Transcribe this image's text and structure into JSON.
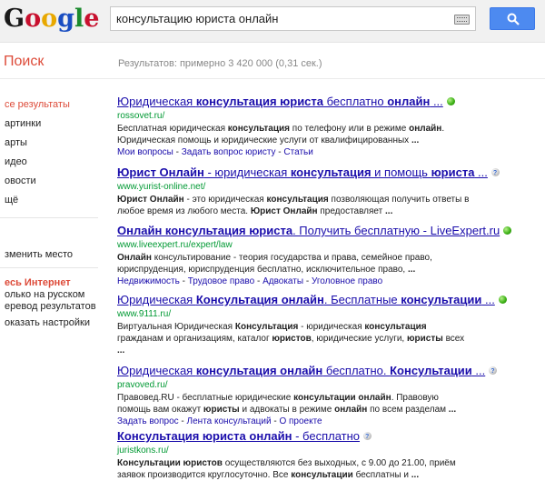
{
  "header": {
    "logo_letters": [
      {
        "ch": "G",
        "color": "#1a1a1a"
      },
      {
        "ch": "o",
        "color": "#c8102e"
      },
      {
        "ch": "o",
        "color": "#e8a800"
      },
      {
        "ch": "g",
        "color": "#1a4ec2"
      },
      {
        "ch": "l",
        "color": "#1b8a2e"
      },
      {
        "ch": "e",
        "color": "#c8102e"
      }
    ],
    "search_query": "консультацию юриста онлайн"
  },
  "section_title": "Поиск",
  "stats": "Результатов: примерно 3 420 000 (0,31 сек.)",
  "sidebar": {
    "nav": [
      {
        "label": "се результаты",
        "active": true
      },
      {
        "label": "артинки",
        "active": false
      },
      {
        "label": "арты",
        "active": false
      },
      {
        "label": "идео",
        "active": false
      },
      {
        "label": "овости",
        "active": false
      },
      {
        "label": "щё",
        "active": false
      }
    ],
    "location": "зменить место",
    "filter_head": "есь Интернет",
    "filters": [
      "олько на русском",
      "еревод результатов"
    ],
    "settings": "оказать настройки"
  },
  "results": [
    {
      "title_parts": [
        {
          "t": "Юридическая ",
          "b": false
        },
        {
          "t": "консультация юриста",
          "b": true
        },
        {
          "t": " бесплатно ",
          "b": false
        },
        {
          "t": "онлайн",
          "b": true
        },
        {
          "t": " ...",
          "b": false
        }
      ],
      "badge": "green",
      "url": "rossovet.ru/",
      "snippet": [
        [
          {
            "t": "Бесплатная юридическая ",
            "b": false
          },
          {
            "t": "консультация",
            "b": true
          },
          {
            "t": " по телефону или в режиме ",
            "b": false
          },
          {
            "t": "онлайн",
            "b": true
          },
          {
            "t": ".",
            "b": false
          }
        ],
        [
          {
            "t": "Юридическая помощь и юридические услуги от квалифицированных ",
            "b": false
          },
          {
            "t": "...",
            "b": true
          }
        ]
      ],
      "sitelinks": [
        "Мои вопросы",
        "Задать вопрос юристу",
        "Статьи"
      ]
    },
    {
      "title_parts": [
        {
          "t": "Юрист Онлайн",
          "b": true
        },
        {
          "t": " - юридическая ",
          "b": false
        },
        {
          "t": "консультация",
          "b": true
        },
        {
          "t": " и помощь ",
          "b": false
        },
        {
          "t": "юриста",
          "b": true
        },
        {
          "t": " ...",
          "b": false
        }
      ],
      "badge": "gray",
      "url": "www.yurist-online.net/",
      "snippet": [
        [
          {
            "t": "Юрист Онлайн",
            "b": true
          },
          {
            "t": " - это юридическая ",
            "b": false
          },
          {
            "t": "консультация",
            "b": true
          },
          {
            "t": " позволяющая получить ответы в",
            "b": false
          }
        ],
        [
          {
            "t": "любое время из любого места. ",
            "b": false
          },
          {
            "t": "Юрист Онлайн",
            "b": true
          },
          {
            "t": " предоставляет ",
            "b": false
          },
          {
            "t": "...",
            "b": true
          }
        ]
      ],
      "sitelinks": []
    },
    {
      "title_parts": [
        {
          "t": "Онлайн консультация юриста",
          "b": true
        },
        {
          "t": ". Получить бесплатную - LiveExpert.ru",
          "b": false
        }
      ],
      "badge": "green",
      "url": "www.liveexpert.ru/expert/law",
      "snippet": [
        [
          {
            "t": "Онлайн",
            "b": true
          },
          {
            "t": " консультирование - теория государства и права, семейное право,",
            "b": false
          }
        ],
        [
          {
            "t": "юриспруденция, юриспруденция бесплатно, исключительное право, ",
            "b": false
          },
          {
            "t": "...",
            "b": true
          }
        ]
      ],
      "sitelinks": [
        "Недвижимость",
        "Трудовое право",
        "Адвокаты",
        "Уголовное право"
      ]
    },
    {
      "title_parts": [
        {
          "t": "Юридическая ",
          "b": false
        },
        {
          "t": "Консультация онлайн",
          "b": true
        },
        {
          "t": ". Бесплатные ",
          "b": false
        },
        {
          "t": "консультации",
          "b": true
        },
        {
          "t": " ...",
          "b": false
        }
      ],
      "badge": "green",
      "url": "www.9111.ru/",
      "snippet": [
        [
          {
            "t": "Виртуальная Юридическая ",
            "b": false
          },
          {
            "t": "Консультация",
            "b": true
          },
          {
            "t": " - юридическая ",
            "b": false
          },
          {
            "t": "консультация",
            "b": true
          }
        ],
        [
          {
            "t": "гражданам и организациям, каталог ",
            "b": false
          },
          {
            "t": "юристов",
            "b": true
          },
          {
            "t": ", юридические услуги, ",
            "b": false
          },
          {
            "t": "юристы",
            "b": true
          },
          {
            "t": " всех",
            "b": false
          }
        ],
        [
          {
            "t": "...",
            "b": true
          }
        ]
      ],
      "sitelinks": []
    },
    {
      "title_parts": [
        {
          "t": "Юридическая ",
          "b": false
        },
        {
          "t": "консультация онлайн",
          "b": true
        },
        {
          "t": " бесплатно. ",
          "b": false
        },
        {
          "t": "Консультации",
          "b": true
        },
        {
          "t": " ...",
          "b": false
        }
      ],
      "badge": "gray",
      "url": "pravoved.ru/",
      "snippet": [
        [
          {
            "t": "Правовед.RU - бесплатные юридические ",
            "b": false
          },
          {
            "t": "консультации онлайн",
            "b": true
          },
          {
            "t": ". Правовую",
            "b": false
          }
        ],
        [
          {
            "t": "помощь вам окажут ",
            "b": false
          },
          {
            "t": "юристы",
            "b": true
          },
          {
            "t": " и адвокаты в режиме ",
            "b": false
          },
          {
            "t": "онлайн",
            "b": true
          },
          {
            "t": " по всем разделам ",
            "b": false
          },
          {
            "t": "...",
            "b": true
          }
        ]
      ],
      "sitelinks": [
        "Задать вопрос",
        "Лента консультаций",
        "О проекте"
      ]
    },
    {
      "title_parts": [
        {
          "t": "Консультация юриста онлайн",
          "b": true
        },
        {
          "t": " - бесплатно",
          "b": false
        }
      ],
      "badge": "gray",
      "url": "juristkons.ru/",
      "snippet": [
        [
          {
            "t": "Консультации юристов",
            "b": true
          },
          {
            "t": " осуществляются без выходных, с 9.00 до 21.00, приём",
            "b": false
          }
        ],
        [
          {
            "t": "заявок производится круглосуточно. Все ",
            "b": false
          },
          {
            "t": "консультации",
            "b": true
          },
          {
            "t": " бесплатны и ",
            "b": false
          },
          {
            "t": "...",
            "b": true
          }
        ]
      ],
      "sitelinks": []
    }
  ]
}
